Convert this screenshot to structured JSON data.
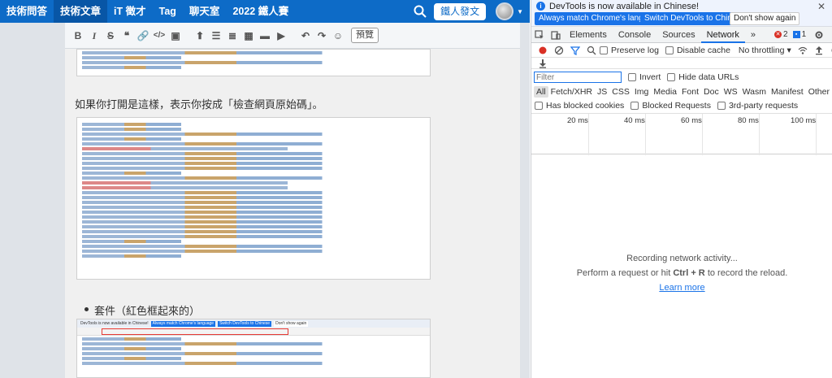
{
  "site": {
    "nav": [
      "技術問答",
      "技術文章",
      "iT 徵才",
      "Tag",
      "聊天室",
      "2022 鐵人賽"
    ],
    "active_nav": "技術文章",
    "post_button": "鐵人發文"
  },
  "editor": {
    "toolbar_icons": [
      "bold-icon",
      "italic-icon",
      "strikethrough-icon",
      "quote-icon",
      "link-icon",
      "code-icon",
      "image-icon",
      "upload-icon",
      "list-ol-icon",
      "list-ul-icon",
      "table-icon",
      "hr-icon",
      "undo-icon",
      "redo-icon",
      "emoji-icon"
    ],
    "preview_label": "預覽",
    "paragraph_1": "如果你打開是這樣，表示你按成「檢查網頁原始碼」。",
    "bullet_1": "套件（紅色框起來的）",
    "embedded_shot_bar": {
      "text": "DevTools is now available in Chinese!",
      "btn1": "Always match Chrome's language",
      "btn2": "Switch DevTools to Chinese",
      "btn3": "Don't show again"
    }
  },
  "devtools": {
    "info_text": "DevTools is now available in Chinese!",
    "btn_match": "Always match Chrome's language",
    "btn_switch": "Switch DevTools to Chinese",
    "btn_dont": "Don't show again",
    "tabs": [
      "Elements",
      "Console",
      "Sources",
      "Network"
    ],
    "active_tab": "Network",
    "error_count": "2",
    "message_count": "1",
    "preserve_log": "Preserve log",
    "disable_cache": "Disable cache",
    "throttling": "No throttling",
    "filter_placeholder": "Filter",
    "invert": "Invert",
    "hide_data_urls": "Hide data URLs",
    "types": [
      "All",
      "Fetch/XHR",
      "JS",
      "CSS",
      "Img",
      "Media",
      "Font",
      "Doc",
      "WS",
      "Wasm",
      "Manifest",
      "Other"
    ],
    "has_blocked_cookies": "Has blocked cookies",
    "blocked_requests": "Blocked Requests",
    "third_party": "3rd-party requests",
    "timeline_labels": [
      "20 ms",
      "40 ms",
      "60 ms",
      "80 ms",
      "100 ms"
    ],
    "recording": "Recording network activity...",
    "perform_request_prefix": "Perform a request or hit ",
    "shortcut": "Ctrl + R",
    "perform_request_suffix": " to record the reload.",
    "learn_more": "Learn more"
  },
  "colors": {
    "site_blue": "#0d6bc7",
    "devtools_blue": "#1a73e8",
    "record_red": "#d93025"
  }
}
